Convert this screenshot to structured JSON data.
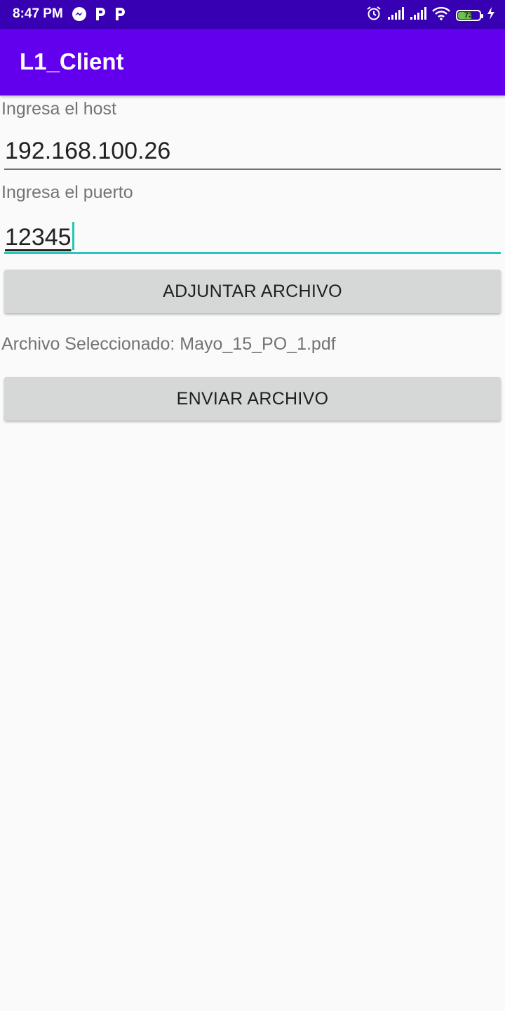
{
  "status_bar": {
    "time": "8:47 PM",
    "left_icons": [
      "messenger-icon",
      "p-app-icon",
      "p-app-icon"
    ],
    "right_icons": [
      "alarm-icon",
      "signal-icon",
      "signal-icon",
      "wifi-icon",
      "battery-icon",
      "charging-icon"
    ],
    "battery_level": "73",
    "battery_fraction": 0.73,
    "background_color": "#3700b3"
  },
  "app_bar": {
    "title": "L1_Client",
    "background_color": "#6200ee"
  },
  "form": {
    "host_label": "Ingresa el host",
    "host_value": "192.168.100.26",
    "port_label": "Ingresa el puerto",
    "port_value": "12345",
    "focus_color": "#26c6b8"
  },
  "buttons": {
    "attach_label": "ADJUNTAR ARCHIVO",
    "send_label": "ENVIAR ARCHIVO"
  },
  "selected_file": {
    "text": "Archivo Seleccionado: Mayo_15_PO_1.pdf"
  }
}
